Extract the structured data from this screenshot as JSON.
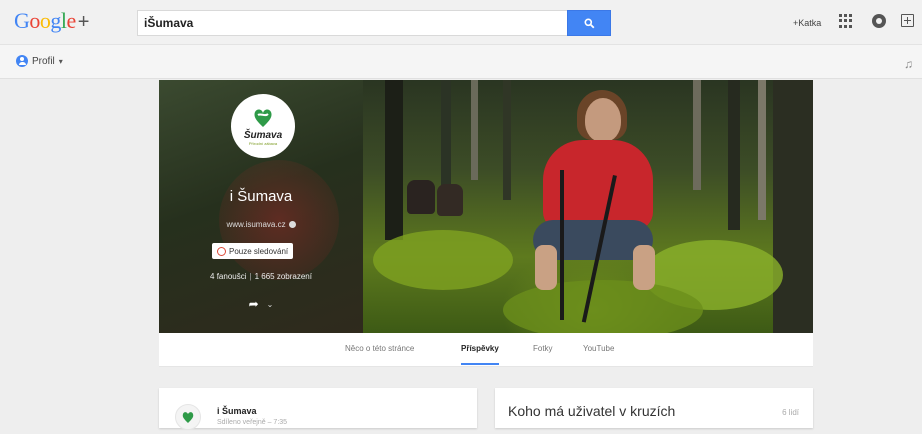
{
  "header": {
    "logo": [
      "G",
      "o",
      "o",
      "g",
      "l",
      "e",
      "+"
    ],
    "search_value": "iŠumava",
    "user_link": "+Katka"
  },
  "subbar": {
    "profile_label": "Profil"
  },
  "page": {
    "brand_wordmark": "Šumava",
    "brand_tagline": "Přírodní zábava",
    "name": "i Šumava",
    "url": "www.isumava.cz",
    "follow_label": "Pouze sledování",
    "followers": "4 fanoušci",
    "views": "1 665 zobrazení"
  },
  "tabs": [
    {
      "label": "Něco o této stránce",
      "active": false
    },
    {
      "label": "Příspěvky",
      "active": true
    },
    {
      "label": "Fotky",
      "active": false
    },
    {
      "label": "YouTube",
      "active": false
    }
  ],
  "post": {
    "author": "i Šumava",
    "meta": "Sdíleno veřejně – 7:35"
  },
  "circles": {
    "title": "Koho má uživatel v kruzích",
    "count": "6 lidí"
  },
  "colors": {
    "accent": "#4285f4",
    "follow_red": "#dd4b39",
    "jacket": "#c8262c"
  },
  "icons": [
    "search-icon",
    "apps-icon",
    "notifications-icon",
    "share-icon",
    "profile-icon",
    "bell-icon",
    "verified-icon",
    "follow-icon",
    "share-arrow-icon",
    "chevron-down-icon"
  ]
}
